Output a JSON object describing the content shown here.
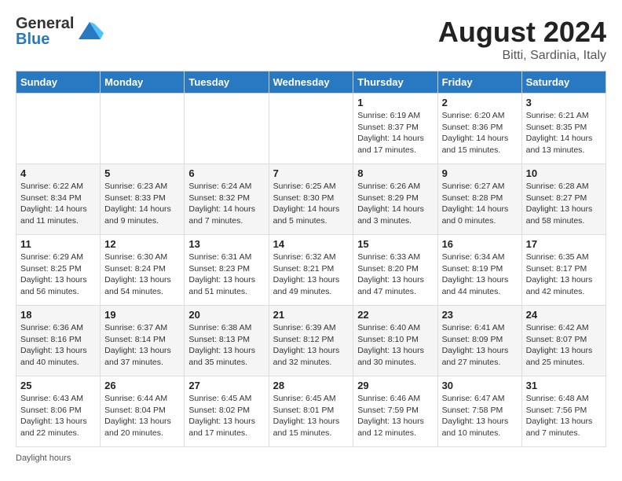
{
  "header": {
    "logo_general": "General",
    "logo_blue": "Blue",
    "month_year": "August 2024",
    "location": "Bitti, Sardinia, Italy"
  },
  "days_of_week": [
    "Sunday",
    "Monday",
    "Tuesday",
    "Wednesday",
    "Thursday",
    "Friday",
    "Saturday"
  ],
  "footer": {
    "daylight_label": "Daylight hours"
  },
  "weeks": [
    [
      {
        "day": "",
        "sunrise": "",
        "sunset": "",
        "daylight": ""
      },
      {
        "day": "",
        "sunrise": "",
        "sunset": "",
        "daylight": ""
      },
      {
        "day": "",
        "sunrise": "",
        "sunset": "",
        "daylight": ""
      },
      {
        "day": "",
        "sunrise": "",
        "sunset": "",
        "daylight": ""
      },
      {
        "day": "1",
        "sunrise": "6:19 AM",
        "sunset": "8:37 PM",
        "daylight": "14 hours and 17 minutes."
      },
      {
        "day": "2",
        "sunrise": "6:20 AM",
        "sunset": "8:36 PM",
        "daylight": "14 hours and 15 minutes."
      },
      {
        "day": "3",
        "sunrise": "6:21 AM",
        "sunset": "8:35 PM",
        "daylight": "14 hours and 13 minutes."
      }
    ],
    [
      {
        "day": "4",
        "sunrise": "6:22 AM",
        "sunset": "8:34 PM",
        "daylight": "14 hours and 11 minutes."
      },
      {
        "day": "5",
        "sunrise": "6:23 AM",
        "sunset": "8:33 PM",
        "daylight": "14 hours and 9 minutes."
      },
      {
        "day": "6",
        "sunrise": "6:24 AM",
        "sunset": "8:32 PM",
        "daylight": "14 hours and 7 minutes."
      },
      {
        "day": "7",
        "sunrise": "6:25 AM",
        "sunset": "8:30 PM",
        "daylight": "14 hours and 5 minutes."
      },
      {
        "day": "8",
        "sunrise": "6:26 AM",
        "sunset": "8:29 PM",
        "daylight": "14 hours and 3 minutes."
      },
      {
        "day": "9",
        "sunrise": "6:27 AM",
        "sunset": "8:28 PM",
        "daylight": "14 hours and 0 minutes."
      },
      {
        "day": "10",
        "sunrise": "6:28 AM",
        "sunset": "8:27 PM",
        "daylight": "13 hours and 58 minutes."
      }
    ],
    [
      {
        "day": "11",
        "sunrise": "6:29 AM",
        "sunset": "8:25 PM",
        "daylight": "13 hours and 56 minutes."
      },
      {
        "day": "12",
        "sunrise": "6:30 AM",
        "sunset": "8:24 PM",
        "daylight": "13 hours and 54 minutes."
      },
      {
        "day": "13",
        "sunrise": "6:31 AM",
        "sunset": "8:23 PM",
        "daylight": "13 hours and 51 minutes."
      },
      {
        "day": "14",
        "sunrise": "6:32 AM",
        "sunset": "8:21 PM",
        "daylight": "13 hours and 49 minutes."
      },
      {
        "day": "15",
        "sunrise": "6:33 AM",
        "sunset": "8:20 PM",
        "daylight": "13 hours and 47 minutes."
      },
      {
        "day": "16",
        "sunrise": "6:34 AM",
        "sunset": "8:19 PM",
        "daylight": "13 hours and 44 minutes."
      },
      {
        "day": "17",
        "sunrise": "6:35 AM",
        "sunset": "8:17 PM",
        "daylight": "13 hours and 42 minutes."
      }
    ],
    [
      {
        "day": "18",
        "sunrise": "6:36 AM",
        "sunset": "8:16 PM",
        "daylight": "13 hours and 40 minutes."
      },
      {
        "day": "19",
        "sunrise": "6:37 AM",
        "sunset": "8:14 PM",
        "daylight": "13 hours and 37 minutes."
      },
      {
        "day": "20",
        "sunrise": "6:38 AM",
        "sunset": "8:13 PM",
        "daylight": "13 hours and 35 minutes."
      },
      {
        "day": "21",
        "sunrise": "6:39 AM",
        "sunset": "8:12 PM",
        "daylight": "13 hours and 32 minutes."
      },
      {
        "day": "22",
        "sunrise": "6:40 AM",
        "sunset": "8:10 PM",
        "daylight": "13 hours and 30 minutes."
      },
      {
        "day": "23",
        "sunrise": "6:41 AM",
        "sunset": "8:09 PM",
        "daylight": "13 hours and 27 minutes."
      },
      {
        "day": "24",
        "sunrise": "6:42 AM",
        "sunset": "8:07 PM",
        "daylight": "13 hours and 25 minutes."
      }
    ],
    [
      {
        "day": "25",
        "sunrise": "6:43 AM",
        "sunset": "8:06 PM",
        "daylight": "13 hours and 22 minutes."
      },
      {
        "day": "26",
        "sunrise": "6:44 AM",
        "sunset": "8:04 PM",
        "daylight": "13 hours and 20 minutes."
      },
      {
        "day": "27",
        "sunrise": "6:45 AM",
        "sunset": "8:02 PM",
        "daylight": "13 hours and 17 minutes."
      },
      {
        "day": "28",
        "sunrise": "6:45 AM",
        "sunset": "8:01 PM",
        "daylight": "13 hours and 15 minutes."
      },
      {
        "day": "29",
        "sunrise": "6:46 AM",
        "sunset": "7:59 PM",
        "daylight": "13 hours and 12 minutes."
      },
      {
        "day": "30",
        "sunrise": "6:47 AM",
        "sunset": "7:58 PM",
        "daylight": "13 hours and 10 minutes."
      },
      {
        "day": "31",
        "sunrise": "6:48 AM",
        "sunset": "7:56 PM",
        "daylight": "13 hours and 7 minutes."
      }
    ]
  ]
}
